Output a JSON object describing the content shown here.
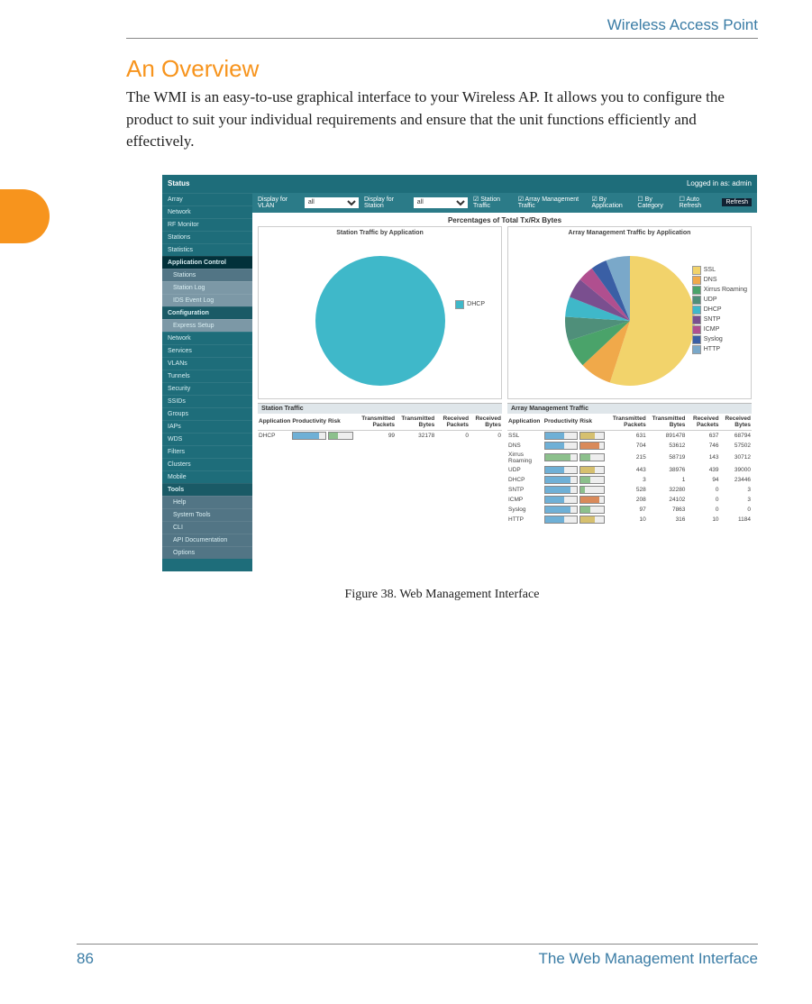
{
  "running_head": "Wireless Access Point",
  "section_title": "An Overview",
  "body_text": "The WMI is an easy-to-use graphical interface to your Wireless AP. It allows you to configure the product to suit your individual requirements and ensure that the unit functions efficiently and effectively.",
  "figure_caption": "Figure 38. Web Management Interface",
  "footer": {
    "page": "86",
    "title": "The Web Management Interface"
  },
  "shot": {
    "topbar": {
      "status": "Status",
      "logged_in": "Logged in as: admin"
    },
    "filterbar": {
      "vlan_label": "Display for VLAN",
      "vlan_value": "all",
      "station_label": "Display for Station",
      "station_value": "all",
      "cb_station": "Station Traffic",
      "cb_array": "Array Management Traffic",
      "cb_app": "By Application",
      "cb_cat": "By Category",
      "auto_refresh": "Auto Refresh",
      "refresh": "Refresh"
    },
    "sidebar": [
      {
        "label": "Array",
        "cls": "item"
      },
      {
        "label": "Network",
        "cls": "item"
      },
      {
        "label": "RF Monitor",
        "cls": "item"
      },
      {
        "label": "Stations",
        "cls": "item"
      },
      {
        "label": "Statistics",
        "cls": "item"
      },
      {
        "label": "Application Control",
        "cls": "item active"
      },
      {
        "label": "Stations",
        "cls": "item sub"
      },
      {
        "label": "Station Log",
        "cls": "item sub2"
      },
      {
        "label": "IDS Event Log",
        "cls": "item sub2"
      },
      {
        "label": "Configuration",
        "cls": "item section"
      },
      {
        "label": "Express Setup",
        "cls": "item sub2"
      },
      {
        "label": "Network",
        "cls": "item"
      },
      {
        "label": "Services",
        "cls": "item"
      },
      {
        "label": "VLANs",
        "cls": "item"
      },
      {
        "label": "Tunnels",
        "cls": "item"
      },
      {
        "label": "Security",
        "cls": "item"
      },
      {
        "label": "SSIDs",
        "cls": "item"
      },
      {
        "label": "Groups",
        "cls": "item"
      },
      {
        "label": "IAPs",
        "cls": "item"
      },
      {
        "label": "WDS",
        "cls": "item"
      },
      {
        "label": "Filters",
        "cls": "item"
      },
      {
        "label": "Clusters",
        "cls": "item"
      },
      {
        "label": "Mobile",
        "cls": "item"
      },
      {
        "label": "Tools",
        "cls": "item section"
      },
      {
        "label": "Help",
        "cls": "item sub"
      },
      {
        "label": "System Tools",
        "cls": "item sub"
      },
      {
        "label": "CLI",
        "cls": "item sub"
      },
      {
        "label": "API Documentation",
        "cls": "item sub"
      },
      {
        "label": "Options",
        "cls": "item sub"
      }
    ],
    "charts_supertitle": "Percentages of Total Tx/Rx Bytes",
    "chart1": {
      "title": "Station Traffic by Application",
      "legend": [
        {
          "name": "DHCP",
          "color": "#3fb8c9"
        }
      ]
    },
    "chart2": {
      "title": "Array Management Traffic by Application",
      "legend": [
        {
          "name": "SSL",
          "color": "#f2d36b"
        },
        {
          "name": "DNS",
          "color": "#f0a94a"
        },
        {
          "name": "Xirrus Roaming",
          "color": "#4aa36a"
        },
        {
          "name": "UDP",
          "color": "#4f8f7a"
        },
        {
          "name": "DHCP",
          "color": "#3fb8c9"
        },
        {
          "name": "SNTP",
          "color": "#7a4f8f"
        },
        {
          "name": "ICMP",
          "color": "#b04f8f"
        },
        {
          "name": "Syslog",
          "color": "#3a5fa5"
        },
        {
          "name": "HTTP",
          "color": "#7aa8c9"
        }
      ]
    },
    "table_headers": [
      "Application",
      "Productivity",
      "Risk",
      "Transmitted Packets",
      "Transmitted Bytes",
      "Received Packets",
      "Received Bytes"
    ],
    "table1": {
      "title": "Station Traffic",
      "rows": [
        {
          "app": "DHCP",
          "prod": 4,
          "prod_color": "#6fb0d6",
          "risk": 2,
          "risk_color": "#8cc08c",
          "tp": 99,
          "tb": 32178,
          "rp": 0,
          "rb": 0
        }
      ]
    },
    "table2": {
      "title": "Array Management Traffic",
      "rows": [
        {
          "app": "SSL",
          "prod": 3,
          "prod_color": "#6fb0d6",
          "risk": 3,
          "risk_color": "#d6c06f",
          "tp": 631,
          "tb": 891478,
          "rp": 637,
          "rb": 68794
        },
        {
          "app": "DNS",
          "prod": 3,
          "prod_color": "#6fb0d6",
          "risk": 4,
          "risk_color": "#d98a5a",
          "tp": 704,
          "tb": 53612,
          "rp": 746,
          "rb": 57502
        },
        {
          "app": "Xirrus Roaming",
          "prod": 4,
          "prod_color": "#8cc08c",
          "risk": 2,
          "risk_color": "#8cc08c",
          "tp": 215,
          "tb": 58719,
          "rp": 143,
          "rb": 30712
        },
        {
          "app": "UDP",
          "prod": 3,
          "prod_color": "#6fb0d6",
          "risk": 3,
          "risk_color": "#d6c06f",
          "tp": 443,
          "tb": 38976,
          "rp": 439,
          "rb": 39000
        },
        {
          "app": "DHCP",
          "prod": 4,
          "prod_color": "#6fb0d6",
          "risk": 2,
          "risk_color": "#8cc08c",
          "tp": 3,
          "tb": 1,
          "rp": 94,
          "rb": 23446
        },
        {
          "app": "SNTP",
          "prod": 4,
          "prod_color": "#6fb0d6",
          "risk": 1,
          "risk_color": "#8cc08c",
          "tp": 528,
          "tb": 32280,
          "rp": 0,
          "rb": 3
        },
        {
          "app": "ICMP",
          "prod": 3,
          "prod_color": "#6fb0d6",
          "risk": 4,
          "risk_color": "#d98a5a",
          "tp": 208,
          "tb": 24102,
          "rp": 0,
          "rb": 3
        },
        {
          "app": "Syslog",
          "prod": 4,
          "prod_color": "#6fb0d6",
          "risk": 2,
          "risk_color": "#8cc08c",
          "tp": 97,
          "tb": 7863,
          "rp": 0,
          "rb": 0
        },
        {
          "app": "HTTP",
          "prod": 3,
          "prod_color": "#6fb0d6",
          "risk": 3,
          "risk_color": "#d6c06f",
          "tp": 10,
          "tb": 316,
          "rp": 10,
          "rb": 1184
        }
      ]
    }
  },
  "chart_data": [
    {
      "type": "pie",
      "title": "Station Traffic by Application",
      "series": [
        {
          "name": "DHCP",
          "value": 100,
          "color": "#3fb8c9"
        }
      ],
      "unit": "percent of total Tx/Rx bytes"
    },
    {
      "type": "pie",
      "title": "Array Management Traffic by Application",
      "series": [
        {
          "name": "SSL",
          "value": 55,
          "color": "#f2d36b"
        },
        {
          "name": "DNS",
          "value": 8,
          "color": "#f0a94a"
        },
        {
          "name": "Xirrus Roaming",
          "value": 7,
          "color": "#4aa36a"
        },
        {
          "name": "UDP",
          "value": 6,
          "color": "#4f8f7a"
        },
        {
          "name": "DHCP",
          "value": 5,
          "color": "#3fb8c9"
        },
        {
          "name": "SNTP",
          "value": 5,
          "color": "#7a4f8f"
        },
        {
          "name": "ICMP",
          "value": 4,
          "color": "#b04f8f"
        },
        {
          "name": "Syslog",
          "value": 4,
          "color": "#3a5fa5"
        },
        {
          "name": "HTTP",
          "value": 6,
          "color": "#7aa8c9"
        }
      ],
      "unit": "percent of total Tx/Rx bytes"
    }
  ]
}
